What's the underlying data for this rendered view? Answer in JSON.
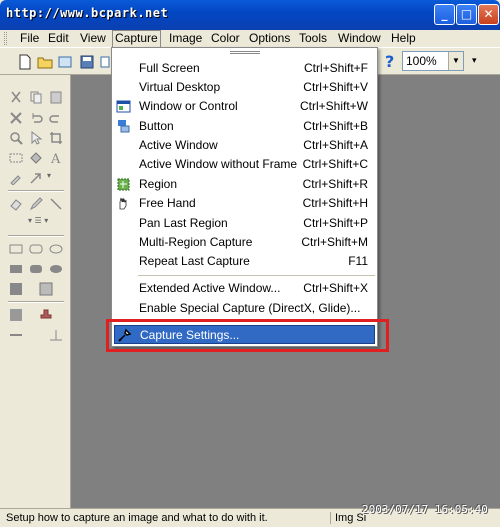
{
  "window": {
    "title": "http://www.bcpark.net",
    "minimize": "_",
    "maximize": "□",
    "close": "✕"
  },
  "menubar": [
    "File",
    "Edit",
    "View",
    "Capture",
    "Image",
    "Color",
    "Options",
    "Tools",
    "Window",
    "Help"
  ],
  "toolbar": {
    "zoom": "100%",
    "help_icon": "?",
    "overflow": "▾"
  },
  "capture_menu": {
    "items": [
      {
        "label": "Full Screen",
        "shortcut": "Ctrl+Shift+F",
        "icon": ""
      },
      {
        "label": "Virtual Desktop",
        "shortcut": "Ctrl+Shift+V",
        "icon": ""
      },
      {
        "label": "Window or Control",
        "shortcut": "Ctrl+Shift+W",
        "icon": "window-icon"
      },
      {
        "label": "Button",
        "shortcut": "Ctrl+Shift+B",
        "icon": "button-icon"
      },
      {
        "label": "Active Window",
        "shortcut": "Ctrl+Shift+A",
        "icon": ""
      },
      {
        "label": "Active Window without Frame",
        "shortcut": "Ctrl+Shift+C",
        "icon": ""
      },
      {
        "label": "Region",
        "shortcut": "Ctrl+Shift+R",
        "icon": "region-icon"
      },
      {
        "label": "Free Hand",
        "shortcut": "Ctrl+Shift+H",
        "icon": "hand-icon"
      },
      {
        "label": "Pan Last Region",
        "shortcut": "Ctrl+Shift+P",
        "icon": ""
      },
      {
        "label": "Multi-Region Capture",
        "shortcut": "Ctrl+Shift+M",
        "icon": ""
      },
      {
        "label": "Repeat Last Capture",
        "shortcut": "F11",
        "icon": ""
      },
      {
        "label": "Extended Active Window...",
        "shortcut": "Ctrl+Shift+X",
        "icon": ""
      },
      {
        "label": "Enable Special Capture (DirectX, Glide)...",
        "shortcut": "",
        "icon": ""
      },
      {
        "label": "Capture Settings...",
        "shortcut": "",
        "icon": "settings-icon"
      }
    ]
  },
  "status": {
    "hint": "Setup how to capture an image and what to do with it.",
    "image_size": "Img Si"
  },
  "watermark": "2003/07/17 16:05:40",
  "colors": {
    "titlebar": "#0347c4",
    "selection": "#316ac5",
    "canvas": "#808080",
    "highlight_border": "#e02020"
  }
}
